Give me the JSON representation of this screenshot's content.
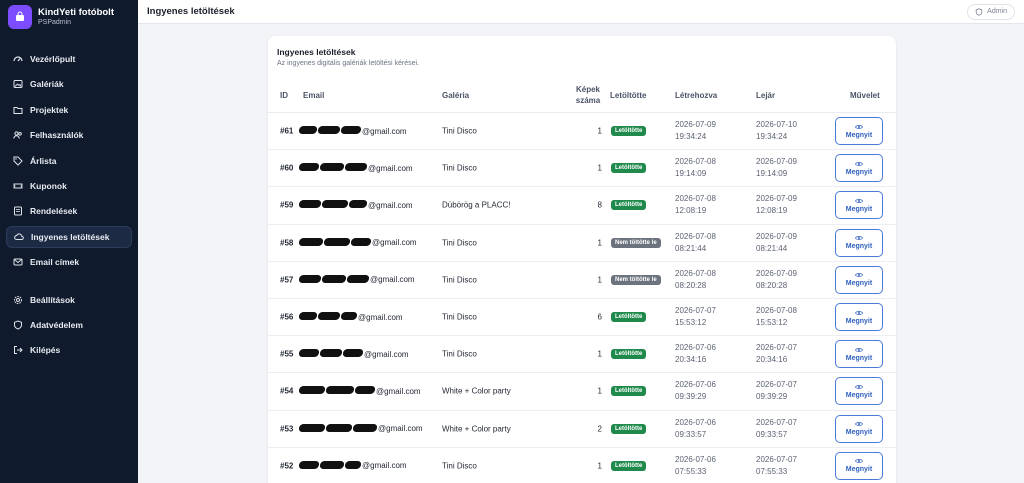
{
  "brand": {
    "title": "KindYeti fotóbolt",
    "subtitle": "PSPadmin"
  },
  "colors": {
    "accent": "#7c4dff",
    "sidebar": "#0f1a2c",
    "badge_ok": "#1f8a4c",
    "badge_no": "#6c737e",
    "button": "#4a7bd8"
  },
  "sidebar": {
    "items": [
      {
        "label": "Vezérlőpult",
        "icon": "dashboard-icon"
      },
      {
        "label": "Galériák",
        "icon": "image-icon"
      },
      {
        "label": "Projektek",
        "icon": "folder-icon"
      },
      {
        "label": "Felhasználók",
        "icon": "users-icon"
      },
      {
        "label": "Árlista",
        "icon": "tag-icon"
      },
      {
        "label": "Kuponok",
        "icon": "ticket-icon"
      },
      {
        "label": "Rendelések",
        "icon": "list-icon"
      },
      {
        "label": "Ingyenes letöltések",
        "icon": "cloud-download-icon"
      },
      {
        "label": "Email címek",
        "icon": "mail-icon"
      }
    ],
    "bottom": [
      {
        "label": "Beállítások",
        "icon": "gear-icon"
      },
      {
        "label": "Adatvédelem",
        "icon": "shield-icon"
      },
      {
        "label": "Kilépés",
        "icon": "logout-icon"
      }
    ]
  },
  "topbar": {
    "title": "Ingyenes letöltések",
    "admin_label": "Admin"
  },
  "card": {
    "title": "Ingyenes letöltések",
    "subtitle": "Az ingyenes digitális galériák letöltési kérései."
  },
  "table": {
    "headers": {
      "id": "ID",
      "email": "Email",
      "gallery": "Galéria",
      "count_line1": "Képek",
      "count_line2": "száma",
      "downloaded": "Letöltötte",
      "created": "Létrehozva",
      "expires": "Lejár",
      "action": "Művelet"
    },
    "action_label": "Megnyit",
    "rows": [
      {
        "id": "#61",
        "email": "@gmail.com",
        "gallery": "Tini Disco",
        "count": "1",
        "status": "Letöltötte",
        "ok": true,
        "created_date": "2026-07-09",
        "created_time": "19:34:24",
        "expires_date": "2026-07-10",
        "expires_time": "19:34:24"
      },
      {
        "id": "#60",
        "email": "@gmail.com",
        "gallery": "Tini Disco",
        "count": "1",
        "status": "Letöltötte",
        "ok": true,
        "created_date": "2026-07-08",
        "created_time": "19:14:09",
        "expires_date": "2026-07-09",
        "expires_time": "19:14:09"
      },
      {
        "id": "#59",
        "email": "@gmail.com",
        "gallery": "Dübörög a PLACC!",
        "count": "8",
        "status": "Letöltötte",
        "ok": true,
        "created_date": "2026-07-08",
        "created_time": "12:08:19",
        "expires_date": "2026-07-09",
        "expires_time": "12:08:19"
      },
      {
        "id": "#58",
        "email": "@gmail.com",
        "gallery": "Tini Disco",
        "count": "1",
        "status": "Nem töltötte le",
        "ok": false,
        "created_date": "2026-07-08",
        "created_time": "08:21:44",
        "expires_date": "2026-07-09",
        "expires_time": "08:21:44"
      },
      {
        "id": "#57",
        "email": "@gmail.com",
        "gallery": "Tini Disco",
        "count": "1",
        "status": "Nem töltötte le",
        "ok": false,
        "created_date": "2026-07-08",
        "created_time": "08:20:28",
        "expires_date": "2026-07-09",
        "expires_time": "08:20:28"
      },
      {
        "id": "#56",
        "email": "@gmail.com",
        "gallery": "Tini Disco",
        "count": "6",
        "status": "Letöltötte",
        "ok": true,
        "created_date": "2026-07-07",
        "created_time": "15:53:12",
        "expires_date": "2026-07-08",
        "expires_time": "15:53:12"
      },
      {
        "id": "#55",
        "email": "@gmail.com",
        "gallery": "Tini Disco",
        "count": "1",
        "status": "Letöltötte",
        "ok": true,
        "created_date": "2026-07-06",
        "created_time": "20:34:16",
        "expires_date": "2026-07-07",
        "expires_time": "20:34:16"
      },
      {
        "id": "#54",
        "email": "@gmail.com",
        "gallery": "White + Color party",
        "count": "1",
        "status": "Letöltötte",
        "ok": true,
        "created_date": "2026-07-06",
        "created_time": "09:39:29",
        "expires_date": "2026-07-07",
        "expires_time": "09:39:29"
      },
      {
        "id": "#53",
        "email": "@gmail.com",
        "gallery": "White + Color party",
        "count": "2",
        "status": "Letöltötte",
        "ok": true,
        "created_date": "2026-07-06",
        "created_time": "09:33:57",
        "expires_date": "2026-07-07",
        "expires_time": "09:33:57"
      },
      {
        "id": "#52",
        "email": "@gmail.com",
        "gallery": "Tini Disco",
        "count": "1",
        "status": "Letöltötte",
        "ok": true,
        "created_date": "2026-07-06",
        "created_time": "07:55:33",
        "expires_date": "2026-07-07",
        "expires_time": "07:55:33"
      }
    ]
  }
}
